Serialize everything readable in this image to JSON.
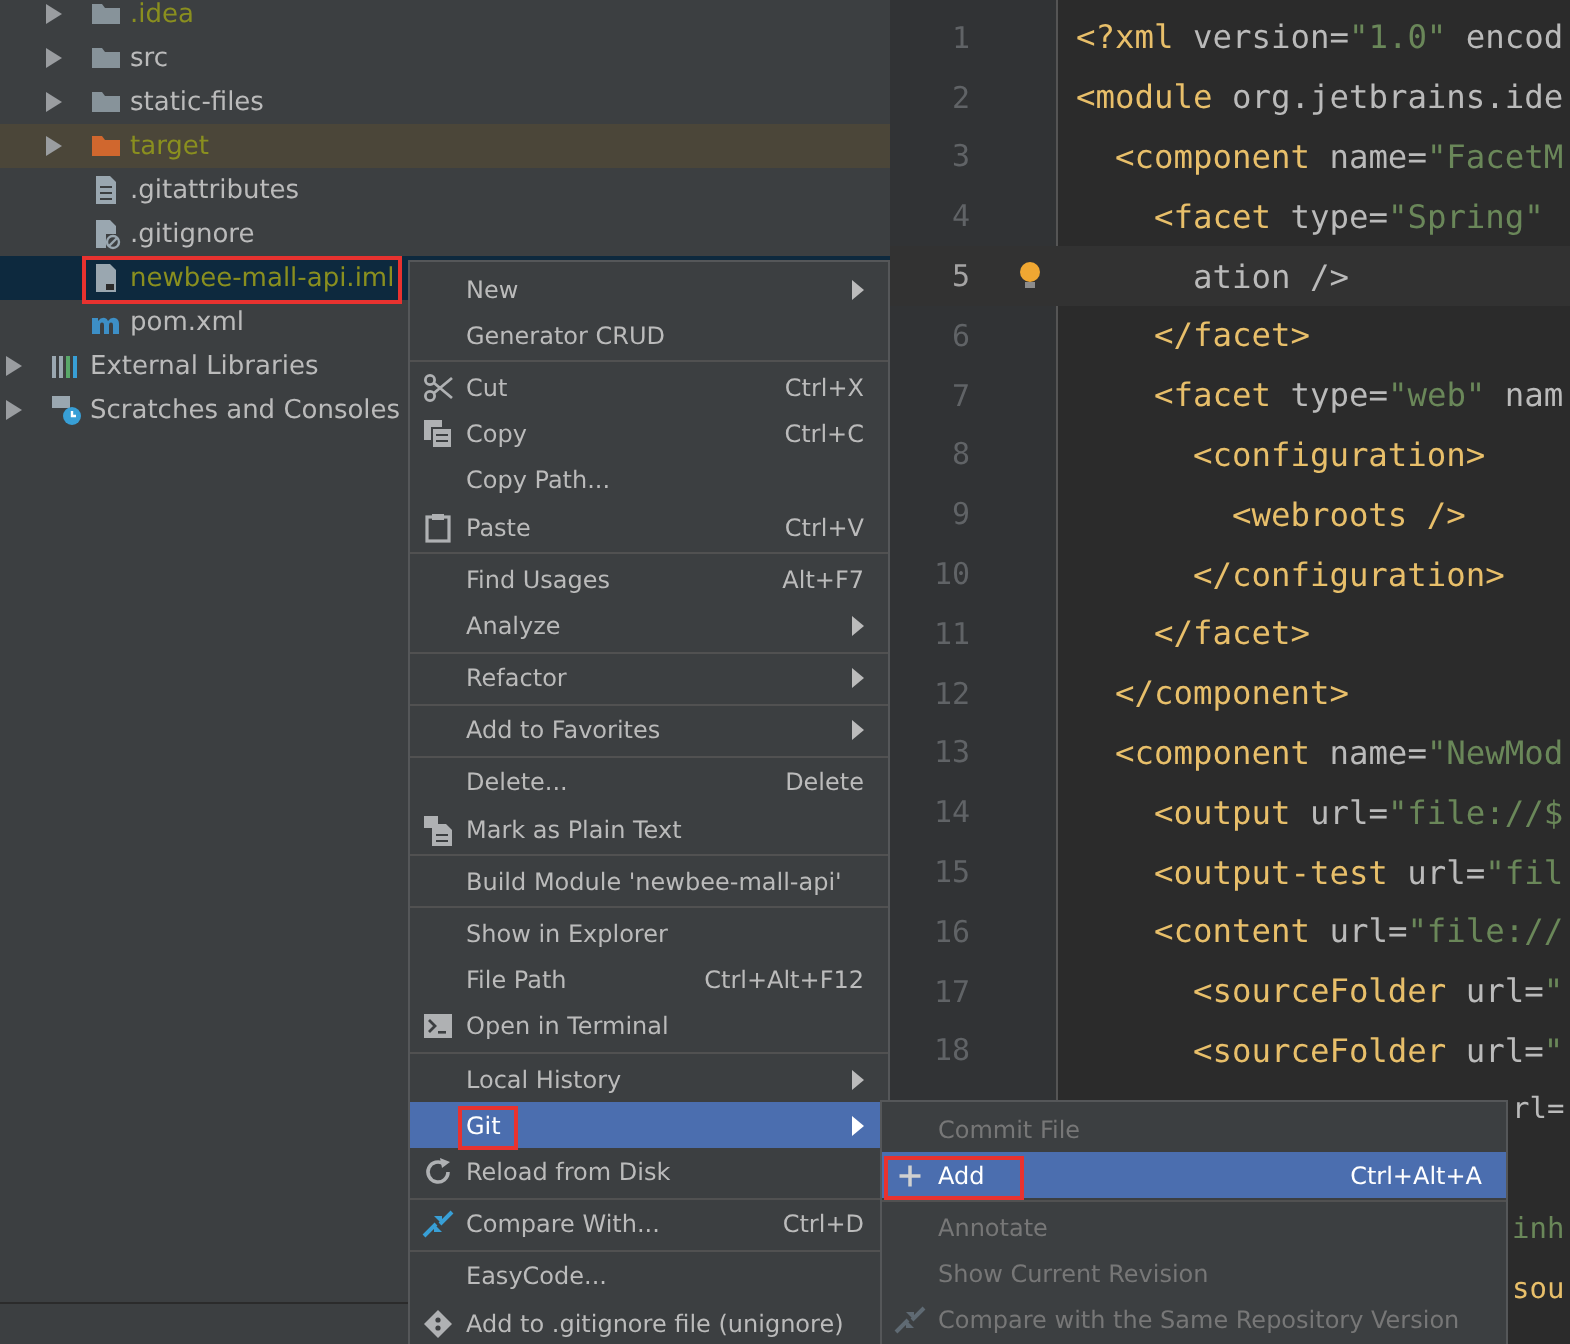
{
  "project_tree": {
    "module_contents": [
      {
        "label": ".idea",
        "kind": "folder",
        "expandable": true,
        "color": "#8a8f1f",
        "selected": false,
        "annotated": false
      },
      {
        "label": "src",
        "kind": "folder",
        "expandable": true,
        "color": "#bbbbbb",
        "selected": false,
        "annotated": false
      },
      {
        "label": "static-files",
        "kind": "folder",
        "expandable": true,
        "color": "#bbbbbb",
        "selected": false,
        "annotated": false
      },
      {
        "label": "target",
        "kind": "excluded-folder",
        "expandable": true,
        "color": "#8a8f1f",
        "selected": false,
        "annotated": false
      },
      {
        "label": ".gitattributes",
        "kind": "text-file",
        "expandable": false,
        "color": "#bbbbbb",
        "selected": false,
        "annotated": false
      },
      {
        "label": ".gitignore",
        "kind": "ignore-file",
        "expandable": false,
        "color": "#bbbbbb",
        "selected": false,
        "annotated": false
      },
      {
        "label": "newbee-mall-api.iml",
        "kind": "module-file",
        "expandable": false,
        "color": "#8a8f1f",
        "selected": true,
        "annotated": true
      },
      {
        "label": "pom.xml",
        "kind": "maven",
        "expandable": false,
        "color": "#bbbbbb",
        "selected": false,
        "annotated": false
      }
    ],
    "top_level": [
      {
        "label": "External Libraries",
        "kind": "libraries",
        "expandable": true,
        "color": "#bbbbbb",
        "selected": false,
        "annotated": false
      },
      {
        "label": "Scratches and Consoles",
        "kind": "scratches",
        "expandable": true,
        "color": "#bbbbbb",
        "selected": false,
        "annotated": false
      }
    ]
  },
  "editor": {
    "lines": [
      {
        "number": "1",
        "current": false,
        "tokens": [
          {
            "text": "<?xml",
            "kind": "tag"
          },
          {
            "text": " version",
            "kind": "attr"
          },
          {
            "text": "=",
            "kind": "plain"
          },
          {
            "text": "\"1.0\"",
            "kind": "value"
          },
          {
            "text": " encod",
            "kind": "attr"
          }
        ]
      },
      {
        "number": "2",
        "current": false,
        "tokens": [
          {
            "text": "<module",
            "kind": "tag"
          },
          {
            "text": " org.jetbrains.ide",
            "kind": "attr"
          }
        ]
      },
      {
        "number": "3",
        "current": false,
        "tokens": [
          {
            "text": "  <component",
            "kind": "tag"
          },
          {
            "text": " name",
            "kind": "attr"
          },
          {
            "text": "=",
            "kind": "plain"
          },
          {
            "text": "\"FacetM",
            "kind": "value"
          }
        ]
      },
      {
        "number": "4",
        "current": false,
        "tokens": [
          {
            "text": "    <facet",
            "kind": "tag"
          },
          {
            "text": " type",
            "kind": "attr"
          },
          {
            "text": "=",
            "kind": "plain"
          },
          {
            "text": "\"Spring\"",
            "kind": "value"
          }
        ]
      },
      {
        "number": "5",
        "current": true,
        "bulb": true,
        "tokens": [
          {
            "text": "      ation />",
            "kind": "attr"
          }
        ]
      },
      {
        "number": "6",
        "current": false,
        "tokens": [
          {
            "text": "    </facet>",
            "kind": "tag"
          }
        ]
      },
      {
        "number": "7",
        "current": false,
        "tokens": [
          {
            "text": "    <facet",
            "kind": "tag"
          },
          {
            "text": " type",
            "kind": "attr"
          },
          {
            "text": "=",
            "kind": "plain"
          },
          {
            "text": "\"web\"",
            "kind": "value"
          },
          {
            "text": " nam",
            "kind": "attr"
          }
        ]
      },
      {
        "number": "8",
        "current": false,
        "tokens": [
          {
            "text": "      <configuration>",
            "kind": "tag"
          }
        ]
      },
      {
        "number": "9",
        "current": false,
        "tokens": [
          {
            "text": "        <webroots />",
            "kind": "tag"
          }
        ]
      },
      {
        "number": "10",
        "current": false,
        "tokens": [
          {
            "text": "      </configuration>",
            "kind": "tag"
          }
        ]
      },
      {
        "number": "11",
        "current": false,
        "tokens": [
          {
            "text": "    </facet>",
            "kind": "tag"
          }
        ]
      },
      {
        "number": "12",
        "current": false,
        "tokens": [
          {
            "text": "  </component>",
            "kind": "tag"
          }
        ]
      },
      {
        "number": "13",
        "current": false,
        "tokens": [
          {
            "text": "  <component",
            "kind": "tag"
          },
          {
            "text": " name",
            "kind": "attr"
          },
          {
            "text": "=",
            "kind": "plain"
          },
          {
            "text": "\"NewMod",
            "kind": "value"
          }
        ]
      },
      {
        "number": "14",
        "current": false,
        "tokens": [
          {
            "text": "    <output",
            "kind": "tag"
          },
          {
            "text": " url",
            "kind": "attr"
          },
          {
            "text": "=",
            "kind": "plain"
          },
          {
            "text": "\"file://$",
            "kind": "value"
          }
        ]
      },
      {
        "number": "15",
        "current": false,
        "tokens": [
          {
            "text": "    <output-test",
            "kind": "tag"
          },
          {
            "text": " url",
            "kind": "attr"
          },
          {
            "text": "=",
            "kind": "plain"
          },
          {
            "text": "\"fil",
            "kind": "value"
          }
        ]
      },
      {
        "number": "16",
        "current": false,
        "tokens": [
          {
            "text": "    <content",
            "kind": "tag"
          },
          {
            "text": " url",
            "kind": "attr"
          },
          {
            "text": "=",
            "kind": "plain"
          },
          {
            "text": "\"file://",
            "kind": "value"
          }
        ]
      },
      {
        "number": "17",
        "current": false,
        "tokens": [
          {
            "text": "      <sourceFolder",
            "kind": "tag"
          },
          {
            "text": " url",
            "kind": "attr"
          },
          {
            "text": "=",
            "kind": "plain"
          },
          {
            "text": "\"",
            "kind": "value"
          }
        ]
      },
      {
        "number": "18",
        "current": false,
        "tokens": [
          {
            "text": "      <sourceFolder",
            "kind": "tag"
          },
          {
            "text": " url",
            "kind": "attr"
          },
          {
            "text": "=",
            "kind": "plain"
          },
          {
            "text": "\"",
            "kind": "value"
          }
        ]
      }
    ],
    "line_tails_beside_menu": [
      {
        "tokens": [
          {
            "text": "rl",
            "kind": "attr"
          },
          {
            "text": "=",
            "kind": "plain"
          }
        ]
      },
      {
        "tokens": [
          {
            "text": "inh",
            "kind": "value"
          }
        ]
      },
      {
        "tokens": [
          {
            "text": "sou",
            "kind": "tag"
          }
        ]
      }
    ]
  },
  "context_menu": {
    "sections": [
      {
        "items": [
          {
            "label": "New",
            "kind": "plain",
            "submenu": true,
            "selected": false,
            "annotated": false
          },
          {
            "label": "Generator CRUD",
            "kind": "plain",
            "submenu": false,
            "selected": false,
            "annotated": false
          }
        ]
      },
      {
        "items": [
          {
            "label": "Cut",
            "kind": "scissors",
            "shortcut": "Ctrl+X",
            "submenu": false,
            "selected": false,
            "annotated": false
          },
          {
            "label": "Copy",
            "kind": "copy",
            "shortcut": "Ctrl+C",
            "submenu": false,
            "selected": false,
            "annotated": false
          },
          {
            "label": "Copy Path...",
            "kind": "plain",
            "submenu": false,
            "selected": false,
            "annotated": false
          },
          {
            "label": "Paste",
            "kind": "clipboard",
            "shortcut": "Ctrl+V",
            "submenu": false,
            "selected": false,
            "annotated": false
          }
        ]
      },
      {
        "items": [
          {
            "label": "Find Usages",
            "kind": "plain",
            "shortcut": "Alt+F7",
            "submenu": false,
            "selected": false,
            "annotated": false
          },
          {
            "label": "Analyze",
            "kind": "plain",
            "submenu": true,
            "selected": false,
            "annotated": false
          }
        ]
      },
      {
        "items": [
          {
            "label": "Refactor",
            "kind": "plain",
            "submenu": true,
            "selected": false,
            "annotated": false
          }
        ]
      },
      {
        "items": [
          {
            "label": "Add to Favorites",
            "kind": "plain",
            "submenu": true,
            "selected": false,
            "annotated": false
          }
        ]
      },
      {
        "items": [
          {
            "label": "Delete...",
            "kind": "plain",
            "shortcut": "Delete",
            "submenu": false,
            "selected": false,
            "annotated": false
          },
          {
            "label": "Mark as Plain Text",
            "kind": "plain-text",
            "submenu": false,
            "selected": false,
            "annotated": false
          }
        ]
      },
      {
        "items": [
          {
            "label": "Build Module 'newbee-mall-api'",
            "kind": "plain",
            "submenu": false,
            "selected": false,
            "annotated": false
          }
        ]
      },
      {
        "items": [
          {
            "label": "Show in Explorer",
            "kind": "plain",
            "submenu": false,
            "selected": false,
            "annotated": false
          },
          {
            "label": "File Path",
            "kind": "plain",
            "shortcut": "Ctrl+Alt+F12",
            "submenu": false,
            "selected": false,
            "annotated": false
          },
          {
            "label": "Open in Terminal",
            "kind": "terminal",
            "submenu": false,
            "selected": false,
            "annotated": false
          }
        ]
      },
      {
        "items": [
          {
            "label": "Local History",
            "kind": "plain",
            "submenu": true,
            "selected": false,
            "annotated": false
          },
          {
            "label": "Git",
            "kind": "plain",
            "submenu": true,
            "selected": true,
            "annotated": true
          },
          {
            "label": "Reload from Disk",
            "kind": "reload",
            "submenu": false,
            "selected": false,
            "annotated": false
          }
        ]
      },
      {
        "items": [
          {
            "label": "Compare With...",
            "kind": "compare",
            "shortcut": "Ctrl+D",
            "submenu": false,
            "selected": false,
            "annotated": false
          }
        ]
      },
      {
        "items": [
          {
            "label": "EasyCode...",
            "kind": "plain",
            "submenu": false,
            "selected": false,
            "annotated": false
          },
          {
            "label": "Add to .gitignore file (unignore)",
            "kind": "gitignore",
            "submenu": false,
            "selected": false,
            "annotated": false
          }
        ]
      }
    ]
  },
  "git_submenu": {
    "sections": [
      {
        "items": [
          {
            "label": "Commit File",
            "kind": "plain",
            "disabled": true,
            "selected": false,
            "annotated": false
          },
          {
            "label": "Add",
            "kind": "plus",
            "shortcut": "Ctrl+Alt+A",
            "disabled": false,
            "selected": true,
            "annotated": true
          }
        ]
      },
      {
        "items": [
          {
            "label": "Annotate",
            "kind": "plain",
            "disabled": true,
            "selected": false,
            "annotated": false
          },
          {
            "label": "Show Current Revision",
            "kind": "plain",
            "disabled": true,
            "selected": false,
            "annotated": false
          },
          {
            "label": "Compare with the Same Repository Version",
            "kind": "compare",
            "disabled": true,
            "selected": false,
            "annotated": false
          }
        ]
      }
    ]
  }
}
